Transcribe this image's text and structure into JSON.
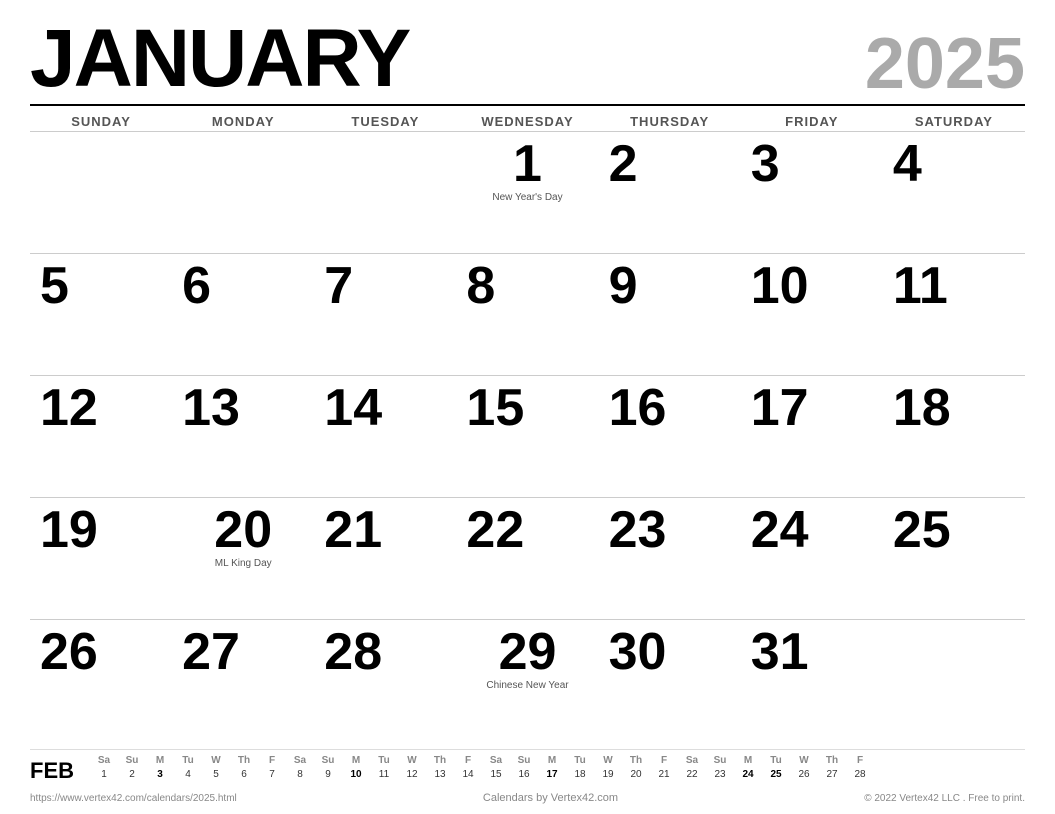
{
  "header": {
    "month": "JANUARY",
    "year": "2025"
  },
  "days_of_week": [
    "SUNDAY",
    "MONDAY",
    "TUESDAY",
    "WEDNESDAY",
    "THURSDAY",
    "FRIDAY",
    "SATURDAY"
  ],
  "weeks": [
    [
      {
        "date": "",
        "holiday": ""
      },
      {
        "date": "",
        "holiday": ""
      },
      {
        "date": "",
        "holiday": ""
      },
      {
        "date": "1",
        "holiday": "New Year's Day"
      },
      {
        "date": "2",
        "holiday": ""
      },
      {
        "date": "3",
        "holiday": ""
      },
      {
        "date": "4",
        "holiday": ""
      }
    ],
    [
      {
        "date": "5",
        "holiday": ""
      },
      {
        "date": "6",
        "holiday": ""
      },
      {
        "date": "7",
        "holiday": ""
      },
      {
        "date": "8",
        "holiday": ""
      },
      {
        "date": "9",
        "holiday": ""
      },
      {
        "date": "10",
        "holiday": ""
      },
      {
        "date": "11",
        "holiday": ""
      }
    ],
    [
      {
        "date": "12",
        "holiday": ""
      },
      {
        "date": "13",
        "holiday": ""
      },
      {
        "date": "14",
        "holiday": ""
      },
      {
        "date": "15",
        "holiday": ""
      },
      {
        "date": "16",
        "holiday": ""
      },
      {
        "date": "17",
        "holiday": ""
      },
      {
        "date": "18",
        "holiday": ""
      }
    ],
    [
      {
        "date": "19",
        "holiday": ""
      },
      {
        "date": "20",
        "holiday": "ML King Day"
      },
      {
        "date": "21",
        "holiday": ""
      },
      {
        "date": "22",
        "holiday": ""
      },
      {
        "date": "23",
        "holiday": ""
      },
      {
        "date": "24",
        "holiday": ""
      },
      {
        "date": "25",
        "holiday": ""
      }
    ],
    [
      {
        "date": "26",
        "holiday": ""
      },
      {
        "date": "27",
        "holiday": ""
      },
      {
        "date": "28",
        "holiday": ""
      },
      {
        "date": "29",
        "holiday": "Chinese New Year"
      },
      {
        "date": "30",
        "holiday": ""
      },
      {
        "date": "31",
        "holiday": ""
      },
      {
        "date": "",
        "holiday": ""
      }
    ]
  ],
  "mini_calendar": {
    "label": "FEB",
    "headers": [
      "Sa",
      "Su",
      "M",
      "Tu",
      "W",
      "Th",
      "F",
      "Sa",
      "Su",
      "M",
      "Tu",
      "W",
      "Th",
      "F",
      "Sa",
      "Su",
      "M",
      "Tu",
      "W",
      "Th",
      "F",
      "Sa",
      "Su",
      "M",
      "Tu",
      "W",
      "Th",
      "F"
    ],
    "rows": [
      [
        "1",
        "2",
        "3",
        "4",
        "5",
        "6",
        "7",
        "8",
        "9",
        "10",
        "11",
        "12",
        "13",
        "14",
        "15",
        "16",
        "17",
        "18",
        "19",
        "20",
        "21",
        "22",
        "23",
        "24",
        "25",
        "26",
        "27",
        "28"
      ]
    ],
    "bold_days": [
      "3",
      "10",
      "17",
      "24",
      "25"
    ]
  },
  "footer": {
    "url": "https://www.vertex42.com/calendars/2025.html",
    "brand": "Calendars by Vertex42.com",
    "copyright": "© 2022 Vertex42 LLC . Free to print."
  }
}
